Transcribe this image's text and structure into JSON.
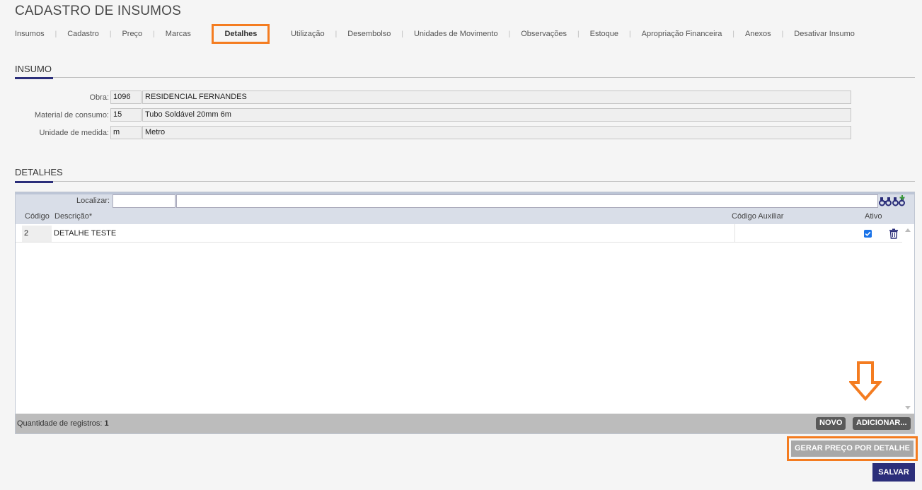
{
  "page": {
    "title": "CADASTRO DE INSUMOS"
  },
  "tabs": [
    {
      "label": "Insumos"
    },
    {
      "label": "Cadastro"
    },
    {
      "label": "Preço"
    },
    {
      "label": "Marcas"
    },
    {
      "label": "Detalhes",
      "active": true
    },
    {
      "label": "Utilização"
    },
    {
      "label": "Desembolso"
    },
    {
      "label": "Unidades de Movimento"
    },
    {
      "label": "Observações"
    },
    {
      "label": "Estoque"
    },
    {
      "label": "Apropriação Financeira"
    },
    {
      "label": "Anexos"
    },
    {
      "label": "Desativar Insumo"
    }
  ],
  "insumo": {
    "section_title": "INSUMO",
    "obra": {
      "label": "Obra:",
      "code": "1096",
      "name": "RESIDENCIAL FERNANDES"
    },
    "material": {
      "label": "Material de consumo:",
      "code": "15",
      "name": "Tubo Soldável 20mm 6m"
    },
    "unidade": {
      "label": "Unidade de medida:",
      "code": "m",
      "name": "Metro"
    }
  },
  "detalhes": {
    "section_title": "DETALHES",
    "search": {
      "label": "Localizar:",
      "value1": "",
      "value2": ""
    },
    "columns": {
      "codigo": "Código",
      "descricao": "Descrição*",
      "codigo_auxiliar": "Código Auxiliar",
      "ativo": "Ativo"
    },
    "rows": [
      {
        "codigo": "2",
        "descricao": "DETALHE TESTE",
        "codigo_auxiliar": "",
        "ativo": true
      }
    ],
    "footer": {
      "count_label": "Quantidade de registros:",
      "count": "1"
    },
    "buttons": {
      "novo": "NOVO",
      "adicionar": "ADICIONAR..."
    }
  },
  "actions": {
    "gerar_preco": "GERAR PREÇO POR DETALHE",
    "salvar": "SALVAR"
  },
  "colors": {
    "accent": "#2b2e7a",
    "highlight": "#f47c20",
    "grid_header": "#d9dee8"
  },
  "icons": [
    "binoculars-icon",
    "binoculars-plus-icon",
    "trash-icon",
    "checkbox-checked-icon",
    "arrow-down-icon"
  ]
}
